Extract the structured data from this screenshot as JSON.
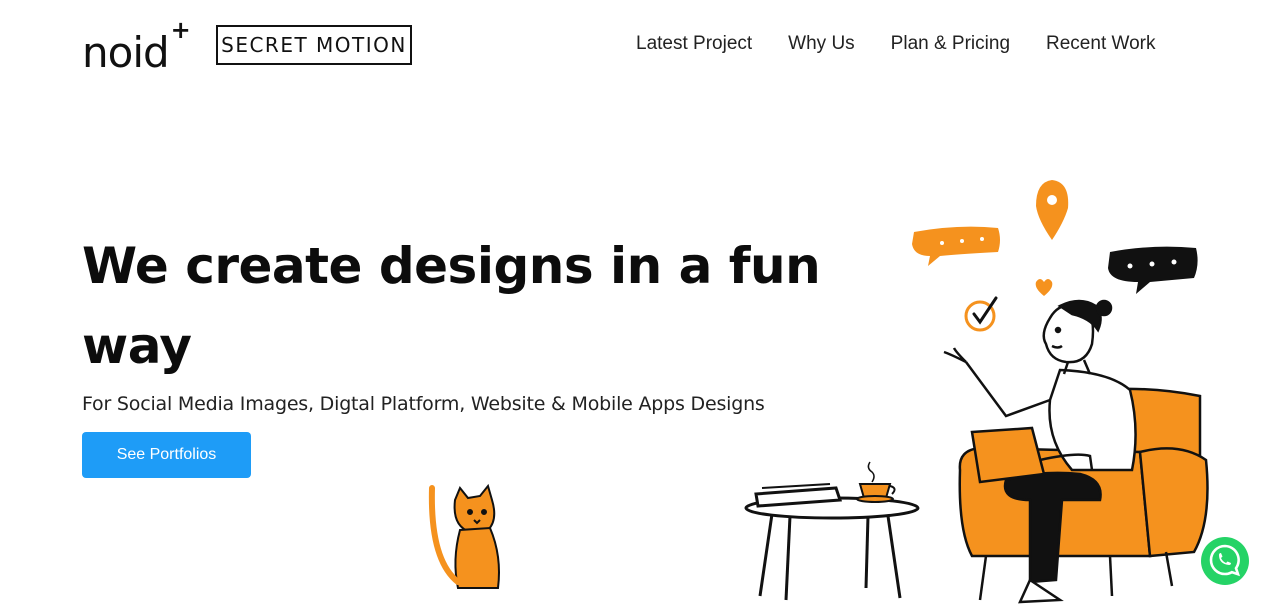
{
  "header": {
    "logo_primary": "noid",
    "logo_primary_sup": "+",
    "logo_secondary": "SECRET MOTION",
    "nav": [
      {
        "label": "Latest Project"
      },
      {
        "label": "Why Us"
      },
      {
        "label": "Plan & Pricing"
      },
      {
        "label": "Recent Work"
      }
    ]
  },
  "hero": {
    "title": "We create designs in a fun way",
    "subtitle": "For Social Media Images, Digtal Platform, Website & Mobile Apps Designs",
    "cta_label": "See Portfolios"
  },
  "colors": {
    "accent": "#1e9cf7",
    "illustration_orange": "#f5921e",
    "whatsapp": "#25d366"
  },
  "icons": [
    "whatsapp-icon",
    "location-pin-icon",
    "heart-icon",
    "checkmark-icon",
    "speech-bubble-icon"
  ]
}
